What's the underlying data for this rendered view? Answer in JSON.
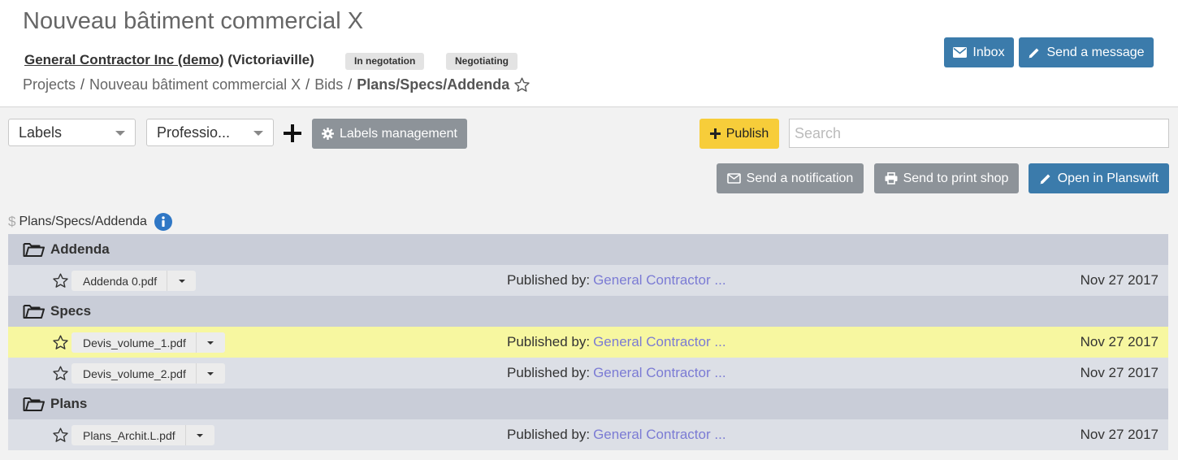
{
  "header": {
    "title": "Nouveau bâtiment commercial X",
    "company_name": "General Contractor Inc (demo)",
    "company_city": "(Victoriaville)",
    "badges": [
      "In negotation",
      "Negotiating"
    ],
    "breadcrumb": [
      "Projects",
      "Nouveau bâtiment commercial X",
      "Bids"
    ],
    "breadcrumb_current": "Plans/Specs/Addenda",
    "separator": "/"
  },
  "actions": {
    "inbox": "Inbox",
    "send_message": "Send a message"
  },
  "toolbar": {
    "labels_select": "Labels",
    "profession_select": "Professio...",
    "labels_management": "Labels management",
    "publish": "Publish",
    "search_placeholder": "Search",
    "send_notification": "Send a notification",
    "send_print_shop": "Send to print shop",
    "open_planswift": "Open in Planswift"
  },
  "section": {
    "dollar": "$",
    "title": "Plans/Specs/Addenda"
  },
  "published_label": "Published by:",
  "folders": [
    {
      "name": "Addenda",
      "files": [
        {
          "name": "Addenda 0.pdf",
          "publisher": "General Contractor ...",
          "date": "Nov 27 2017",
          "highlighted": false
        }
      ]
    },
    {
      "name": "Specs",
      "files": [
        {
          "name": "Devis_volume_1.pdf",
          "publisher": "General Contractor ...",
          "date": "Nov 27 2017",
          "highlighted": true
        },
        {
          "name": "Devis_volume_2.pdf",
          "publisher": "General Contractor ...",
          "date": "Nov 27 2017",
          "highlighted": false
        }
      ]
    },
    {
      "name": "Plans",
      "files": [
        {
          "name": "Plans_Archit.L.pdf",
          "publisher": "General Contractor ...",
          "date": "Nov 27 2017",
          "highlighted": false
        }
      ]
    }
  ],
  "colors": {
    "primary": "#3b7bab",
    "secondary": "#8d9399",
    "publish": "#f7cd3a",
    "highlight": "#f7f7a0",
    "link": "#7b7bd4",
    "info": "#2f77c5"
  }
}
